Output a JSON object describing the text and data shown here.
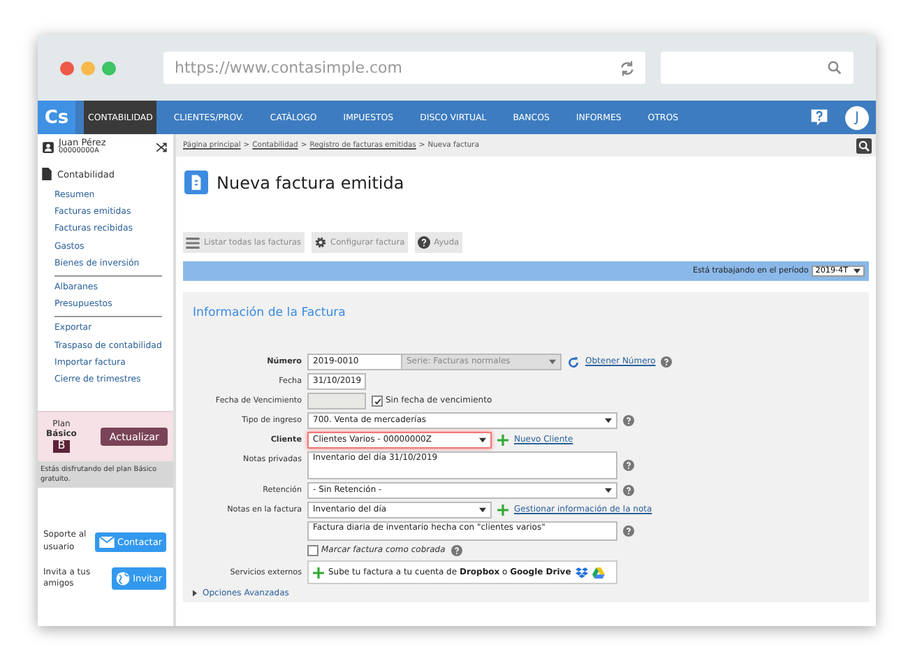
{
  "browser": {
    "url": "https://www.contasimple.com"
  },
  "nav": {
    "logo": "Cs",
    "items": [
      {
        "label": "CONTABILIDAD",
        "selected": true
      },
      {
        "label": "CLIENTES/PROV.",
        "selected": false
      },
      {
        "label": "CATÁLOGO",
        "selected": false
      },
      {
        "label": "IMPUESTOS",
        "selected": false
      },
      {
        "label": "DISCO VIRTUAL",
        "selected": false
      },
      {
        "label": "BANCOS",
        "selected": false
      },
      {
        "label": "INFORMES",
        "selected": false
      },
      {
        "label": "OTROS",
        "selected": false
      }
    ],
    "avatar": "J"
  },
  "user": {
    "name": "Juan Pérez",
    "id": "00000000A"
  },
  "breadcrumb": {
    "separator": ">",
    "items": [
      {
        "label": "Página principal",
        "kind": "link"
      },
      {
        "label": "Contabilidad",
        "kind": "link"
      },
      {
        "label": "Registro de facturas emitidas",
        "kind": "link"
      },
      {
        "label": "Nueva factura",
        "kind": "current"
      }
    ]
  },
  "sidebar": {
    "section": "Contabilidad",
    "groups": [
      [
        "Resumen",
        "Facturas emitidas",
        "Facturas recibidas",
        "Gastos",
        "Bienes de inversión"
      ],
      [
        "Albaranes",
        "Presupuestos"
      ],
      [
        "Exportar",
        "Traspaso de contabilidad",
        "Importar factura",
        "Cierre de trimestres"
      ]
    ]
  },
  "plan": {
    "label": "Plan",
    "name": "Básico",
    "badge": "B",
    "button": "Actualizar",
    "notice": "Estás disfrutando del plan Básico gratuito."
  },
  "support": [
    {
      "text": "Soporte al usuario",
      "button": "Contactar",
      "kind": "mail"
    },
    {
      "text": "Invita a tus amigos",
      "button": "Invitar",
      "kind": "globe"
    }
  ],
  "page": {
    "title": "Nueva factura emitida"
  },
  "toolbar": [
    {
      "label": "Listar todas las facturas",
      "kind": "list"
    },
    {
      "label": "Configurar factura",
      "kind": "gear"
    },
    {
      "label": "Ayuda",
      "kind": "help"
    }
  ],
  "period": {
    "label": "Está trabajando en el período",
    "value": "2019-4T"
  },
  "form": {
    "title": "Información de la Factura",
    "rows": [
      {
        "kind": "number",
        "label": "Número",
        "value": "2019-0010",
        "series": "Serie: Facturas normales",
        "link": "Obtener Número",
        "help": true
      },
      {
        "kind": "input",
        "label": "Fecha",
        "value": "31/10/2019",
        "help": false
      },
      {
        "kind": "due",
        "label": "Fecha de Vencimiento",
        "checkbox_label": "Sin fecha de vencimiento",
        "checked": true,
        "help": false
      },
      {
        "kind": "select",
        "label": "Tipo de ingreso",
        "value": "700. Venta de mercaderías",
        "help": true
      },
      {
        "kind": "client",
        "label": "Cliente",
        "value": "Clientes Varios - 00000000Z",
        "link": "Nuevo Cliente",
        "highlighted": true,
        "help": false
      },
      {
        "kind": "textarea",
        "label": "Notas privadas",
        "value": "Inventario del día 31/10/2019",
        "help": true
      },
      {
        "kind": "select",
        "label": "Retención",
        "value": "- Sin Retención -",
        "help": true
      },
      {
        "kind": "notes",
        "label": "Notas en la factura",
        "value": "Inventario del día",
        "link": "Gestionar información de la nota",
        "text": "Factura diaria de inventario hecha con \"clientes varios\"",
        "help": true
      },
      {
        "kind": "check",
        "checkbox_label": "Marcar factura como cobrada",
        "checked": false,
        "help": true
      },
      {
        "kind": "services",
        "label": "Servicios externos",
        "text": "Sube tu factura a tu cuenta de **Dropbox** o **Google Drive**",
        "help": false
      }
    ],
    "advanced": "Opciones Avanzadas"
  }
}
